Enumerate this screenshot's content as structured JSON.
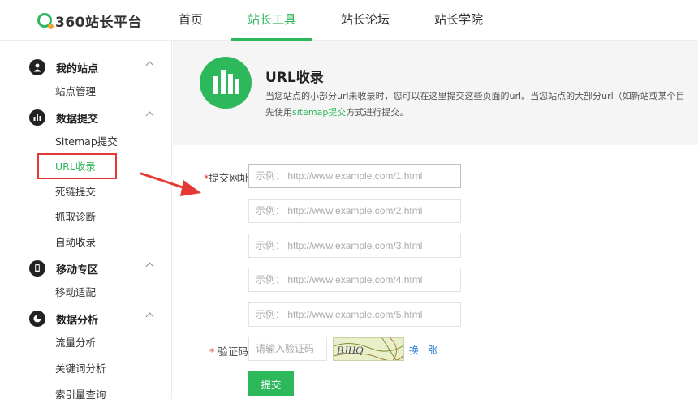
{
  "brand": {
    "name": "360站长平台"
  },
  "nav": [
    {
      "label": "首页",
      "active": false
    },
    {
      "label": "站长工具",
      "active": true
    },
    {
      "label": "站长论坛",
      "active": false
    },
    {
      "label": "站长学院",
      "active": false
    }
  ],
  "sidebar": {
    "groups": [
      {
        "title": "我的站点",
        "icon": "user-icon",
        "items": [
          "站点管理"
        ]
      },
      {
        "title": "数据提交",
        "icon": "bar-chart-icon",
        "items": [
          "Sitemap提交",
          "URL收录",
          "死链提交",
          "抓取诊断",
          "自动收录"
        ]
      },
      {
        "title": "移动专区",
        "icon": "mobile-icon",
        "items": [
          "移动适配"
        ]
      },
      {
        "title": "数据分析",
        "icon": "pie-chart-icon",
        "items": [
          "流量分析",
          "关键词分析",
          "索引量查询"
        ]
      }
    ],
    "active_item": "URL收录"
  },
  "banner": {
    "title": "URL收录",
    "desc_line1": "当您站点的小部分url未收录时，您可以在这里提交这些页面的url。当您站点的大部分url（如新站或某个目",
    "desc_line2_pre": "先使用",
    "desc_line2_link": "sitemap提交",
    "desc_line2_post": "方式进行提交。"
  },
  "form": {
    "url_label": "提交网址",
    "url_placeholders": [
      "示例： http://www.example.com/1.html",
      "示例： http://www.example.com/2.html",
      "示例： http://www.example.com/3.html",
      "示例： http://www.example.com/4.html",
      "示例： http://www.example.com/5.html"
    ],
    "captcha_label": "验证码",
    "captcha_placeholder": "请输入验证码",
    "captcha_text": "BJHQ",
    "refresh_label": "换一张",
    "submit_label": "提交",
    "required_mark": "*"
  },
  "colors": {
    "brand_green": "#2eb85c",
    "highlight_red": "#e53935",
    "link_blue": "#2b7bd6"
  }
}
